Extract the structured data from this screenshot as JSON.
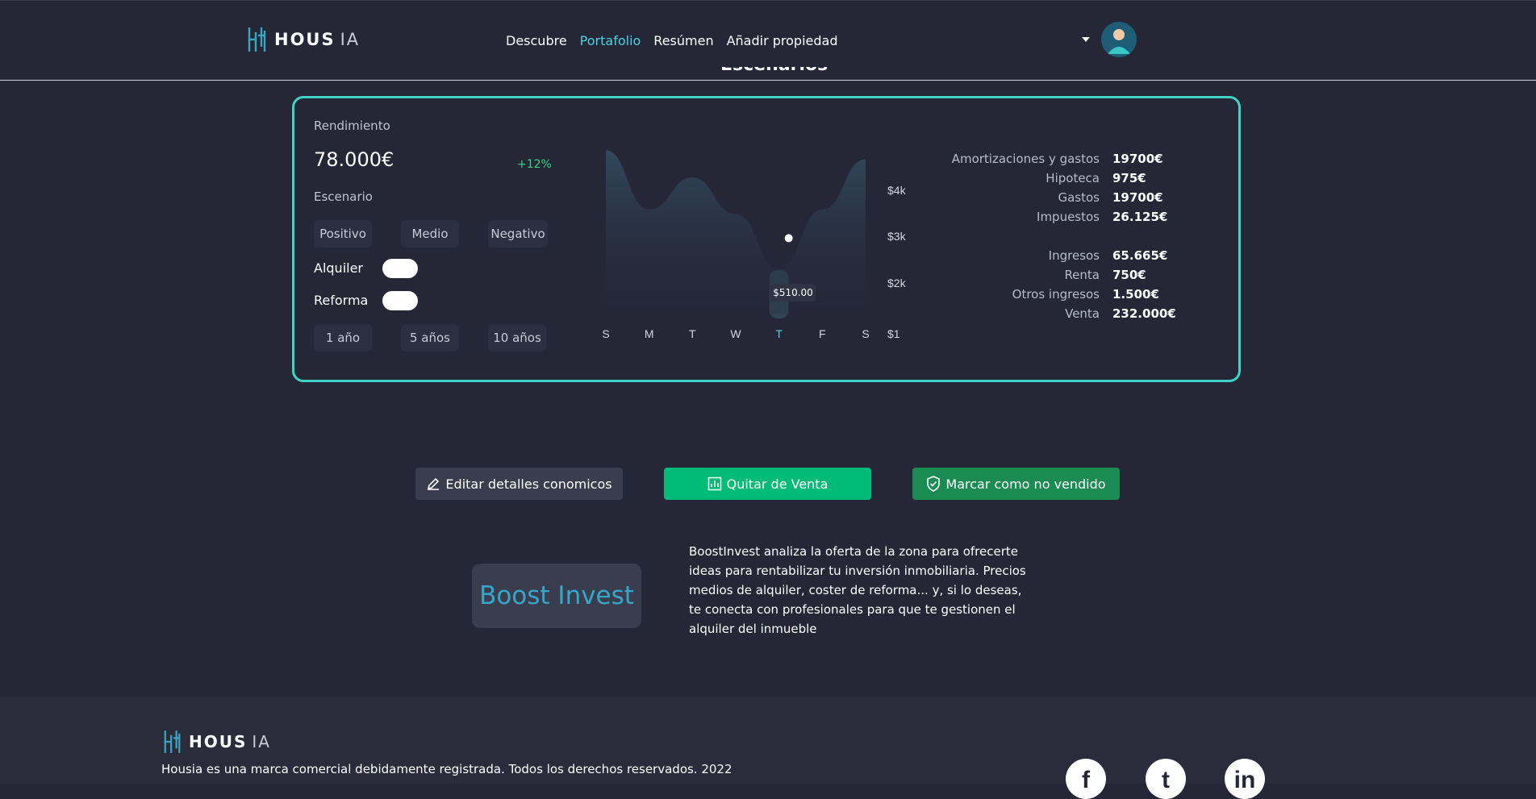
{
  "header": {
    "logo_text": "HOUS",
    "logo_suffix": "IA",
    "nav": [
      "Descubre",
      "Portafolio",
      "Resúmen",
      "Añadir propiedad"
    ],
    "active_nav": "Portafolio"
  },
  "section_title": "Escenarios",
  "card": {
    "performance_label": "Rendimiento",
    "performance_value": "78.000€",
    "performance_change": "+12%",
    "scenario_label": "Escenario",
    "scenario_options": [
      "Positivo",
      "Medio",
      "Negativo"
    ],
    "toggles": [
      {
        "label": "Alquiler"
      },
      {
        "label": "Reforma"
      }
    ],
    "periods": [
      "1 año",
      "5 años",
      "10 años"
    ],
    "chart_tooltip": "$510.00"
  },
  "chart_data": {
    "type": "area",
    "x": [
      "S",
      "M",
      "T",
      "W",
      "T",
      "F",
      "S"
    ],
    "highlight_x_index": 4,
    "y_ticks": [
      "$4k",
      "$3k",
      "$2k",
      "$1"
    ],
    "series": [
      {
        "values": [
          4600,
          3300,
          4000,
          3200,
          2000,
          3300,
          4400
        ]
      }
    ],
    "marker": {
      "x_index": 4,
      "label": "$510.00"
    },
    "colors": {
      "line_fill_top": "#324a5e",
      "highlight": "#4ad3e4"
    }
  },
  "details": {
    "expenses": [
      {
        "key": "Amortizaciones y gastos",
        "value": "19700€"
      },
      {
        "key": "Hipoteca",
        "value": "975€"
      },
      {
        "key": "Gastos",
        "value": "19700€"
      },
      {
        "key": "Impuestos",
        "value": "26.125€"
      }
    ],
    "income": [
      {
        "key": "Ingresos",
        "value": "65.665€"
      },
      {
        "key": "Renta",
        "value": "750€"
      },
      {
        "key": "Otros ingresos",
        "value": "1.500€"
      },
      {
        "key": "Venta",
        "value": "232.000€"
      }
    ]
  },
  "actions": {
    "edit": "Editar detalles conomicos",
    "remove_sale": "Quitar de Venta",
    "mark_unsold": "Marcar como no vendido"
  },
  "boost": {
    "title": "Boost Invest",
    "description": "BoostInvest analiza la oferta de la zona para ofrecerte ideas para rentabilizar tu inversión inmobiliaria. Precios medios de alquiler, coster de reforma... y, si lo deseas, te conecta con profesionales para que te gestionen el alquiler del inmueble"
  },
  "footer": {
    "logo_text": "HOUS",
    "logo_suffix": "IA",
    "note": "Housia es una marca comercial debidamente registrada. Todos los derechos reservados. 2022",
    "social": [
      "f",
      "t",
      "in"
    ]
  },
  "colors": {
    "background": "#252737",
    "accent": "#4ad3e4",
    "card_border": "#3dd4c6",
    "primary_button": "#00bb77",
    "success_button": "#1a8b52"
  }
}
